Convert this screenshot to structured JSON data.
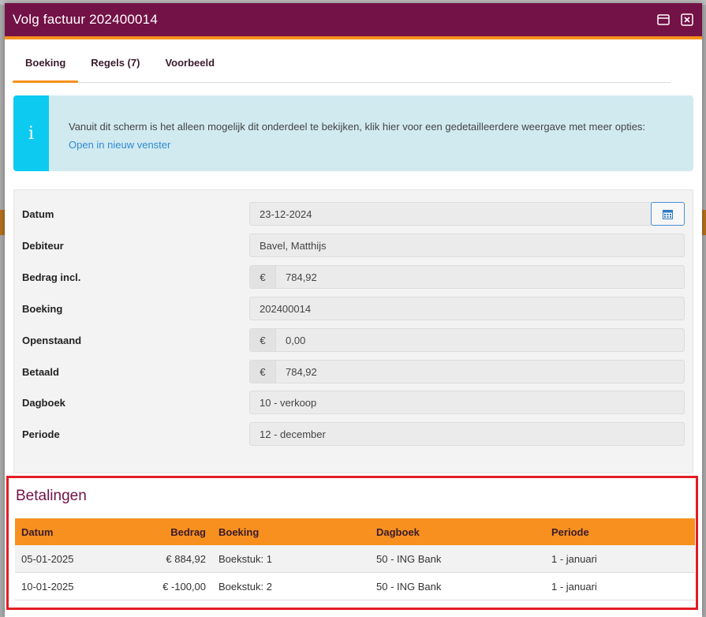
{
  "window": {
    "title": "Volg factuur 202400014"
  },
  "tabs": [
    {
      "label": "Boeking"
    },
    {
      "label": "Regels (7)"
    },
    {
      "label": "Voorbeeld"
    }
  ],
  "info": {
    "text": "Vanuit dit scherm is het alleen mogelijk dit onderdeel te bekijken, klik hier voor een gedetailleerdere weergave met meer opties:",
    "link": "Open in nieuw venster",
    "icon_glyph": "i"
  },
  "form": {
    "datum": {
      "label": "Datum",
      "value": "23-12-2024"
    },
    "debiteur": {
      "label": "Debiteur",
      "value": "Bavel, Matthijs"
    },
    "bedrag_incl": {
      "label": "Bedrag incl.",
      "prefix": "€",
      "value": "784,92"
    },
    "boeking": {
      "label": "Boeking",
      "value": "202400014"
    },
    "openstaand": {
      "label": "Openstaand",
      "prefix": "€",
      "value": "0,00"
    },
    "betaald": {
      "label": "Betaald",
      "prefix": "€",
      "value": "784,92"
    },
    "dagboek": {
      "label": "Dagboek",
      "value": "10 - verkoop"
    },
    "periode": {
      "label": "Periode",
      "value": "12 - december"
    }
  },
  "payments": {
    "title": "Betalingen",
    "headers": {
      "datum": "Datum",
      "bedrag": "Bedrag",
      "boeking": "Boeking",
      "dagboek": "Dagboek",
      "periode": "Periode"
    },
    "rows": [
      {
        "datum": "05-01-2025",
        "bedrag": "€ 884,92",
        "boeking": "Boekstuk: 1",
        "dagboek": "50 - ING Bank",
        "periode": "1 - januari"
      },
      {
        "datum": "10-01-2025",
        "bedrag": "€ -100,00",
        "boeking": "Boekstuk: 2",
        "dagboek": "50 - ING Bank",
        "periode": "1 - januari"
      }
    ]
  },
  "colors": {
    "titlebar": "#731247",
    "accent": "#f7901e",
    "info_side": "#0dcaf0",
    "highlight_border": "#e21d24"
  }
}
